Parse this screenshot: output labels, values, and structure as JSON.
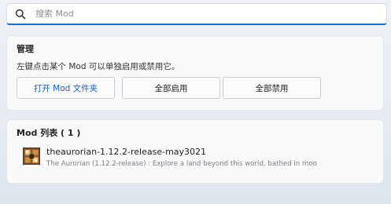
{
  "search": {
    "placeholder": "搜索 Mod"
  },
  "manage": {
    "title": "管理",
    "description": "左键点击某个 Mod 可以单独启用或禁用它。",
    "buttons": {
      "open_folder": "打开 Mod 文件夹",
      "enable_all": "全部启用",
      "disable_all": "全部禁用"
    }
  },
  "mod_list": {
    "title": "Mod 列表 ( 1 )",
    "items": [
      {
        "name": "theaurorian-1.12.2-release-may3021",
        "description": "The Aurorian (1.12.2-release) : Explore a land beyond this world, bathed in moo",
        "icon": "redstone-lamp-icon"
      }
    ]
  },
  "colors": {
    "accent": "#1a6fc2",
    "primary_button_text": "#1a5fb0"
  }
}
